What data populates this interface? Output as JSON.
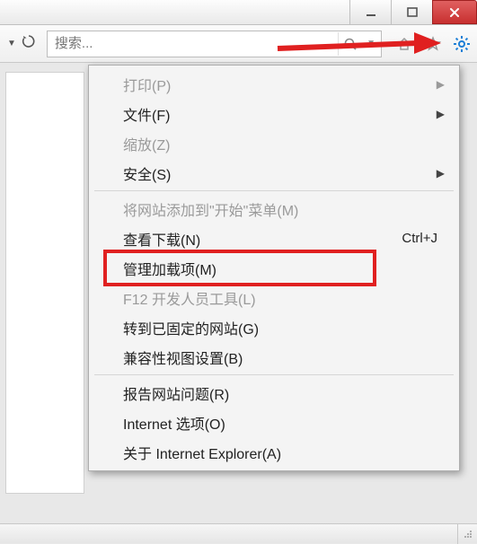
{
  "search": {
    "placeholder": "搜索..."
  },
  "menu": {
    "items": [
      {
        "label": "打印(P)",
        "submenu": true,
        "disabled": true
      },
      {
        "label": "文件(F)",
        "submenu": true
      },
      {
        "label": "缩放(Z)",
        "submenu": false,
        "disabled": true
      },
      {
        "label": "安全(S)",
        "submenu": true
      },
      {
        "separator": true
      },
      {
        "label": "将网站添加到\"开始\"菜单(M)",
        "disabled": true
      },
      {
        "label": "查看下载(N)",
        "shortcut": "Ctrl+J"
      },
      {
        "label": "管理加载项(M)",
        "highlighted": true
      },
      {
        "label": "F12 开发人员工具(L)",
        "disabled": true
      },
      {
        "label": "转到已固定的网站(G)"
      },
      {
        "label": "兼容性视图设置(B)"
      },
      {
        "separator": true
      },
      {
        "label": "报告网站问题(R)"
      },
      {
        "label": "Internet 选项(O)"
      },
      {
        "label": "关于 Internet Explorer(A)"
      }
    ]
  }
}
